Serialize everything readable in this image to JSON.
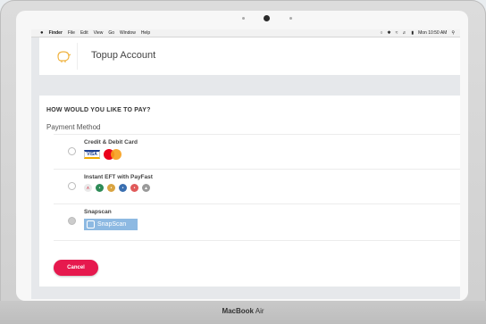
{
  "device": {
    "brand_bold": "MacBook",
    "brand_light": "Air"
  },
  "menubar": {
    "apple": "",
    "items": [
      "Finder",
      "File",
      "Edit",
      "View",
      "Go",
      "Window",
      "Help"
    ],
    "clock": "Mon 10:50 AM"
  },
  "header": {
    "title": "Topup Account"
  },
  "payment": {
    "heading": "HOW WOULD YOU LIKE TO PAY?",
    "method_label": "Payment Method",
    "options": [
      {
        "name": "Credit & Debit Card",
        "logos": [
          "VISA",
          "MasterCard"
        ]
      },
      {
        "name": "Instant EFT with PayFast"
      },
      {
        "name": "Snapscan",
        "badge": "SnapScan"
      }
    ]
  },
  "actions": {
    "cancel": "Cancel"
  },
  "colors": {
    "accent": "#e6194e",
    "snapscan": "#8db9e2"
  }
}
